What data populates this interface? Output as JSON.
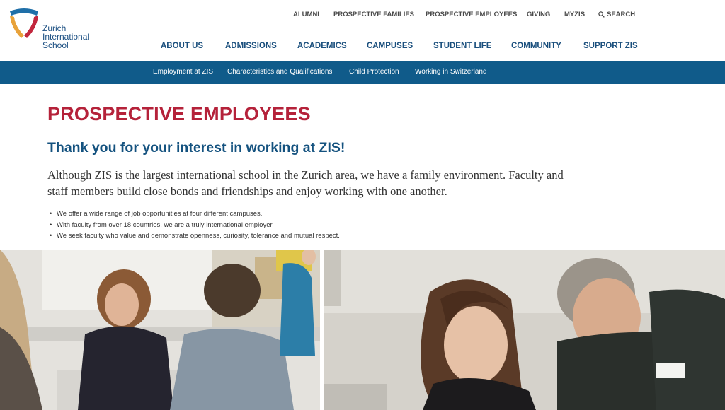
{
  "brand": {
    "name_lines": [
      "Zurich",
      "International",
      "School"
    ]
  },
  "utility_nav": {
    "items": [
      "ALUMNI",
      "PROSPECTIVE FAMILIES",
      "PROSPECTIVE EMPLOYEES",
      "GIVING",
      "MYZIS"
    ],
    "search_label": "SEARCH"
  },
  "main_nav": {
    "items": [
      "ABOUT US",
      "ADMISSIONS",
      "ACADEMICS",
      "CAMPUSES",
      "STUDENT LIFE",
      "COMMUNITY",
      "SUPPORT ZIS"
    ]
  },
  "sub_nav": {
    "items": [
      "Employment at ZIS",
      "Characteristics and Qualifications",
      "Child Protection",
      "Working in Switzerland"
    ]
  },
  "content": {
    "title": "PROSPECTIVE EMPLOYEES",
    "subheading": "Thank you for your interest in working at ZIS!",
    "intro": "Although ZIS is the largest international school in the Zurich area, we have a family environment. Faculty and staff members build close bonds and friendships and enjoy working with one another.",
    "bullets": [
      "We offer a wide range of job opportunities at four different campuses.",
      "With faculty from over 18 countries, we are a truly international employer.",
      "We seek faculty who value and demonstrate openness, curiosity, tolerance and mutual respect."
    ]
  },
  "colors": {
    "nav_blue": "#1a4f7d",
    "subnav_bg": "#105b8a",
    "title_red": "#b5223a",
    "subhead_blue": "#14527f"
  }
}
